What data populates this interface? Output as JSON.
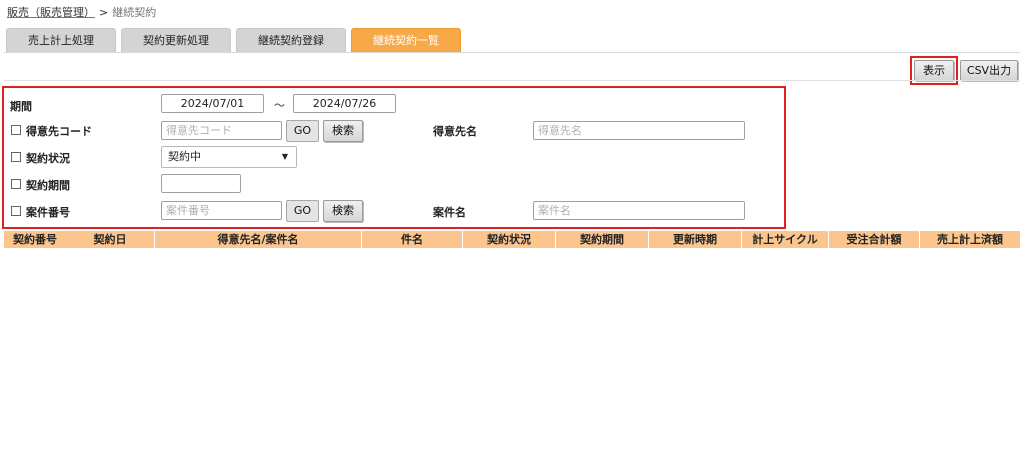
{
  "breadcrumb": {
    "parent": "販売（販売管理）",
    "separator": ">",
    "current": "継続契約"
  },
  "tabs": [
    {
      "label": "売上計上処理",
      "active": false
    },
    {
      "label": "契約更新処理",
      "active": false
    },
    {
      "label": "継続契約登録",
      "active": false
    },
    {
      "label": "継続契約一覧",
      "active": true
    }
  ],
  "toolbar": {
    "display_label": "表示",
    "csv_label": "CSV出力"
  },
  "form": {
    "period": {
      "label": "期間",
      "from": "2024/07/01",
      "separator": "～",
      "to": "2024/07/26"
    },
    "customer_code": {
      "label": "得意先コード",
      "placeholder": "得意先コード",
      "go_label": "GO",
      "search_label": "検索"
    },
    "customer_name": {
      "label": "得意先名",
      "placeholder": "得意先名"
    },
    "contract_status": {
      "label": "契約状況",
      "value": "契約中"
    },
    "contract_period": {
      "label": "契約期間",
      "value": ""
    },
    "project_number": {
      "label": "案件番号",
      "placeholder": "案件番号",
      "go_label": "GO",
      "search_label": "検索"
    },
    "project_name": {
      "label": "案件名",
      "placeholder": "案件名"
    }
  },
  "table": {
    "columns": [
      "契約番号",
      "契約日",
      "得意先名/案件名",
      "件名",
      "契約状況",
      "契約期間",
      "更新時期",
      "計上サイクル",
      "受注合計額",
      "売上計上済額"
    ],
    "rows": []
  },
  "colors": {
    "active_tab": "#f7a948",
    "highlight": "#e0201f",
    "table_header": "#fbc58e"
  }
}
